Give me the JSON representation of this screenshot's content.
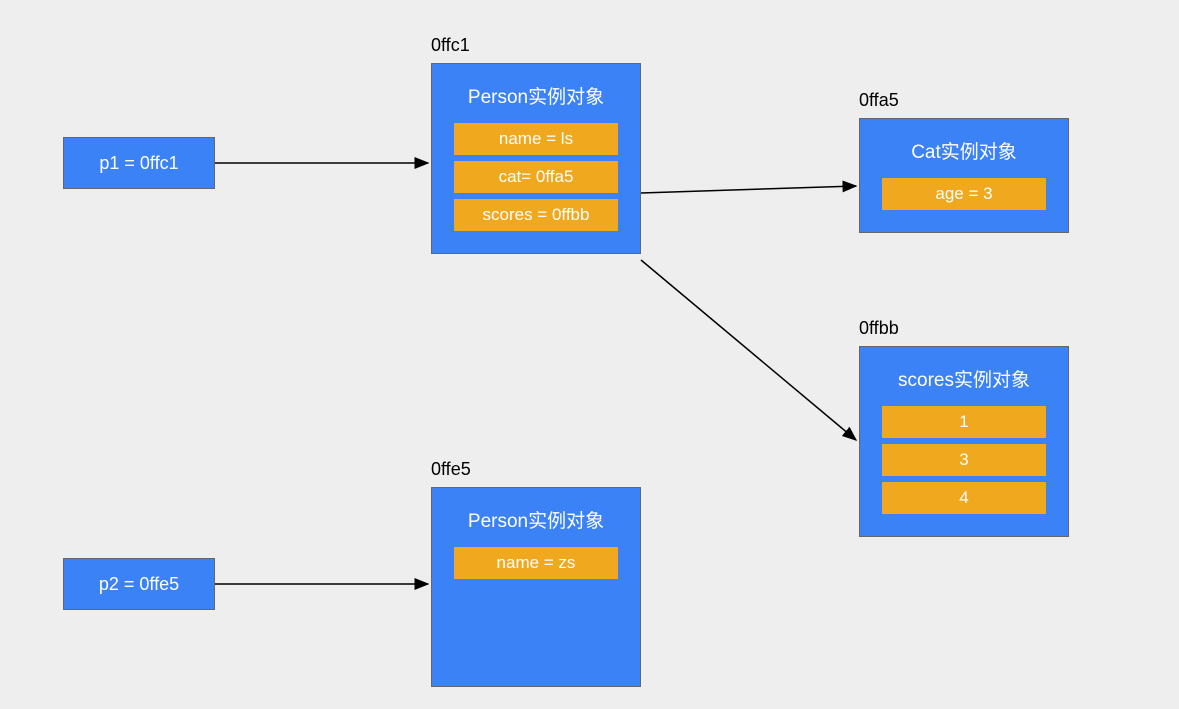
{
  "vars": {
    "p1": {
      "text": "p1 = 0ffc1"
    },
    "p2": {
      "text": "p2 = 0ffe5"
    }
  },
  "objects": {
    "person1": {
      "addr": "0ffc1",
      "title": "Person实例对象",
      "fields": [
        "name = ls",
        "cat= 0ffa5",
        "scores = 0ffbb"
      ]
    },
    "person2": {
      "addr": "0ffe5",
      "title": "Person实例对象",
      "fields": [
        "name = zs"
      ]
    },
    "cat": {
      "addr": "0ffa5",
      "title": "Cat实例对象",
      "fields": [
        "age = 3"
      ]
    },
    "scores": {
      "addr": "0ffbb",
      "title": "scores实例对象",
      "fields": [
        "1",
        "3",
        "4"
      ]
    }
  }
}
